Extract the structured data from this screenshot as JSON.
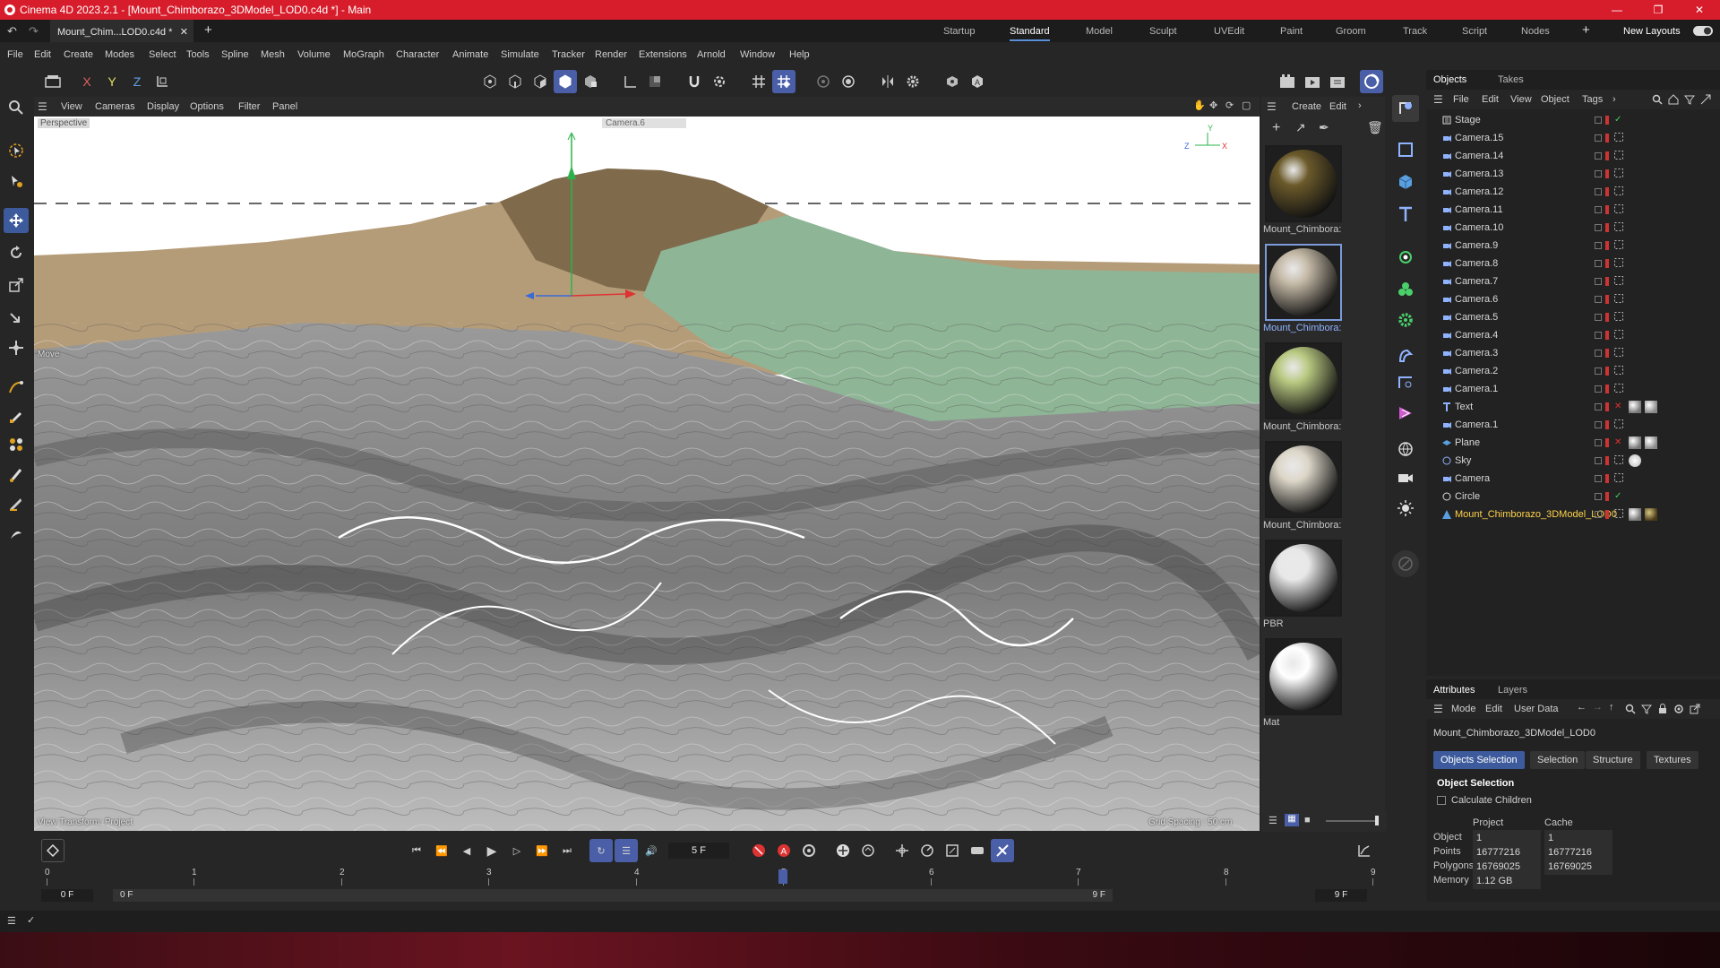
{
  "window": {
    "title": "Cinema 4D 2023.2.1 - [Mount_Chimborazo_3DModel_LOD0.c4d *] - Main"
  },
  "doc_tab": {
    "label": "Mount_Chim...LOD0.c4d *"
  },
  "layouts": [
    "Startup",
    "Standard",
    "Model",
    "Sculpt",
    "UVEdit",
    "Paint",
    "Groom",
    "Track",
    "Script",
    "Nodes"
  ],
  "layouts_active": "Standard",
  "new_layouts": "New Layouts",
  "menu": [
    "File",
    "Edit",
    "Create",
    "Modes",
    "Select",
    "Tools",
    "Spline",
    "Mesh",
    "Volume",
    "MoGraph",
    "Character",
    "Animate",
    "Simulate",
    "Tracker",
    "Render",
    "Extensions",
    "Arnold",
    "Window",
    "Help"
  ],
  "axis_buttons": {
    "x": "X",
    "y": "Y",
    "z": "Z"
  },
  "viewport": {
    "menu": [
      "View",
      "Cameras",
      "Display",
      "Options",
      "Filter",
      "Panel"
    ],
    "perspective": "Perspective",
    "camera": "Camera.6",
    "move_label": "Move",
    "view_transform": "View Transform: Project",
    "grid_spacing": "Grid Spacing : 50 cm",
    "gizmo_labels": {
      "z": "Z",
      "y": "Y",
      "x": "X"
    }
  },
  "materials": {
    "menu": [
      "Create",
      "Edit"
    ],
    "items": [
      {
        "name": "Mount_Chimbora:",
        "color": "#6b5a2a"
      },
      {
        "name": "Mount_Chimbora:",
        "color": "#c4b9a6"
      },
      {
        "name": "Mount_Chimbora:",
        "color": "#b8c880"
      },
      {
        "name": "Mount_Chimbora:",
        "color": "#dcd6c8"
      },
      {
        "name": "PBR",
        "color": "#e8e8e8"
      },
      {
        "name": "Mat",
        "color": "#ffffff"
      }
    ],
    "selected_index": 1
  },
  "objects": {
    "tabs": [
      "Objects",
      "Takes"
    ],
    "menu": [
      "File",
      "Edit",
      "View",
      "Object",
      "Tags"
    ],
    "items": [
      {
        "name": "Stage",
        "icon": "stage-icon"
      },
      {
        "name": "Camera.15",
        "icon": "camera-icon"
      },
      {
        "name": "Camera.14",
        "icon": "camera-icon"
      },
      {
        "name": "Camera.13",
        "icon": "camera-icon"
      },
      {
        "name": "Camera.12",
        "icon": "camera-icon"
      },
      {
        "name": "Camera.11",
        "icon": "camera-icon"
      },
      {
        "name": "Camera.10",
        "icon": "camera-icon"
      },
      {
        "name": "Camera.9",
        "icon": "camera-icon"
      },
      {
        "name": "Camera.8",
        "icon": "camera-icon"
      },
      {
        "name": "Camera.7",
        "icon": "camera-icon"
      },
      {
        "name": "Camera.6",
        "icon": "camera-icon"
      },
      {
        "name": "Camera.5",
        "icon": "camera-icon"
      },
      {
        "name": "Camera.4",
        "icon": "camera-icon"
      },
      {
        "name": "Camera.3",
        "icon": "camera-icon"
      },
      {
        "name": "Camera.2",
        "icon": "camera-icon"
      },
      {
        "name": "Camera.1",
        "icon": "camera-icon"
      },
      {
        "name": "Text",
        "icon": "text-icon"
      },
      {
        "name": "Camera.1",
        "icon": "camera-icon"
      },
      {
        "name": "Plane",
        "icon": "plane-icon"
      },
      {
        "name": "Sky",
        "icon": "sky-icon"
      },
      {
        "name": "Camera",
        "icon": "camera-icon"
      },
      {
        "name": "Circle",
        "icon": "circle-icon"
      },
      {
        "name": "Mount_Chimborazo_3DModel_LOD0",
        "icon": "polygon-object-icon"
      }
    ],
    "selected_index": 22
  },
  "attributes": {
    "tabs": [
      "Attributes",
      "Layers"
    ],
    "menu": [
      "Mode",
      "Edit",
      "User Data"
    ],
    "object_name": "Mount_Chimborazo_3DModel_LOD0",
    "buttons": [
      "Objects Selection",
      "Selection",
      "Structure",
      "Textures"
    ],
    "section_title": "Object Selection",
    "calc_children": "Calculate Children",
    "col_project": "Project",
    "col_cache": "Cache",
    "rows": [
      {
        "label": "Object",
        "project": "1",
        "cache": "1"
      },
      {
        "label": "Points",
        "project": "16777216",
        "cache": "16777216"
      },
      {
        "label": "Polygons",
        "project": "16769025",
        "cache": "16769025"
      },
      {
        "label": "Memory",
        "project": "1.12 GB",
        "cache": ""
      }
    ]
  },
  "timeline": {
    "current_frame": "5 F",
    "ruler": [
      "0",
      "1",
      "2",
      "3",
      "4",
      "5",
      "6",
      "7",
      "8",
      "9"
    ],
    "playhead_frame": 5,
    "start": "0 F",
    "range_start": "0 F",
    "range_end": "9 F",
    "end": "9 F"
  },
  "colors": {
    "titlebar": "#d71d2b",
    "accent": "#4a5fa8",
    "selected_object": "#ffd24a"
  }
}
